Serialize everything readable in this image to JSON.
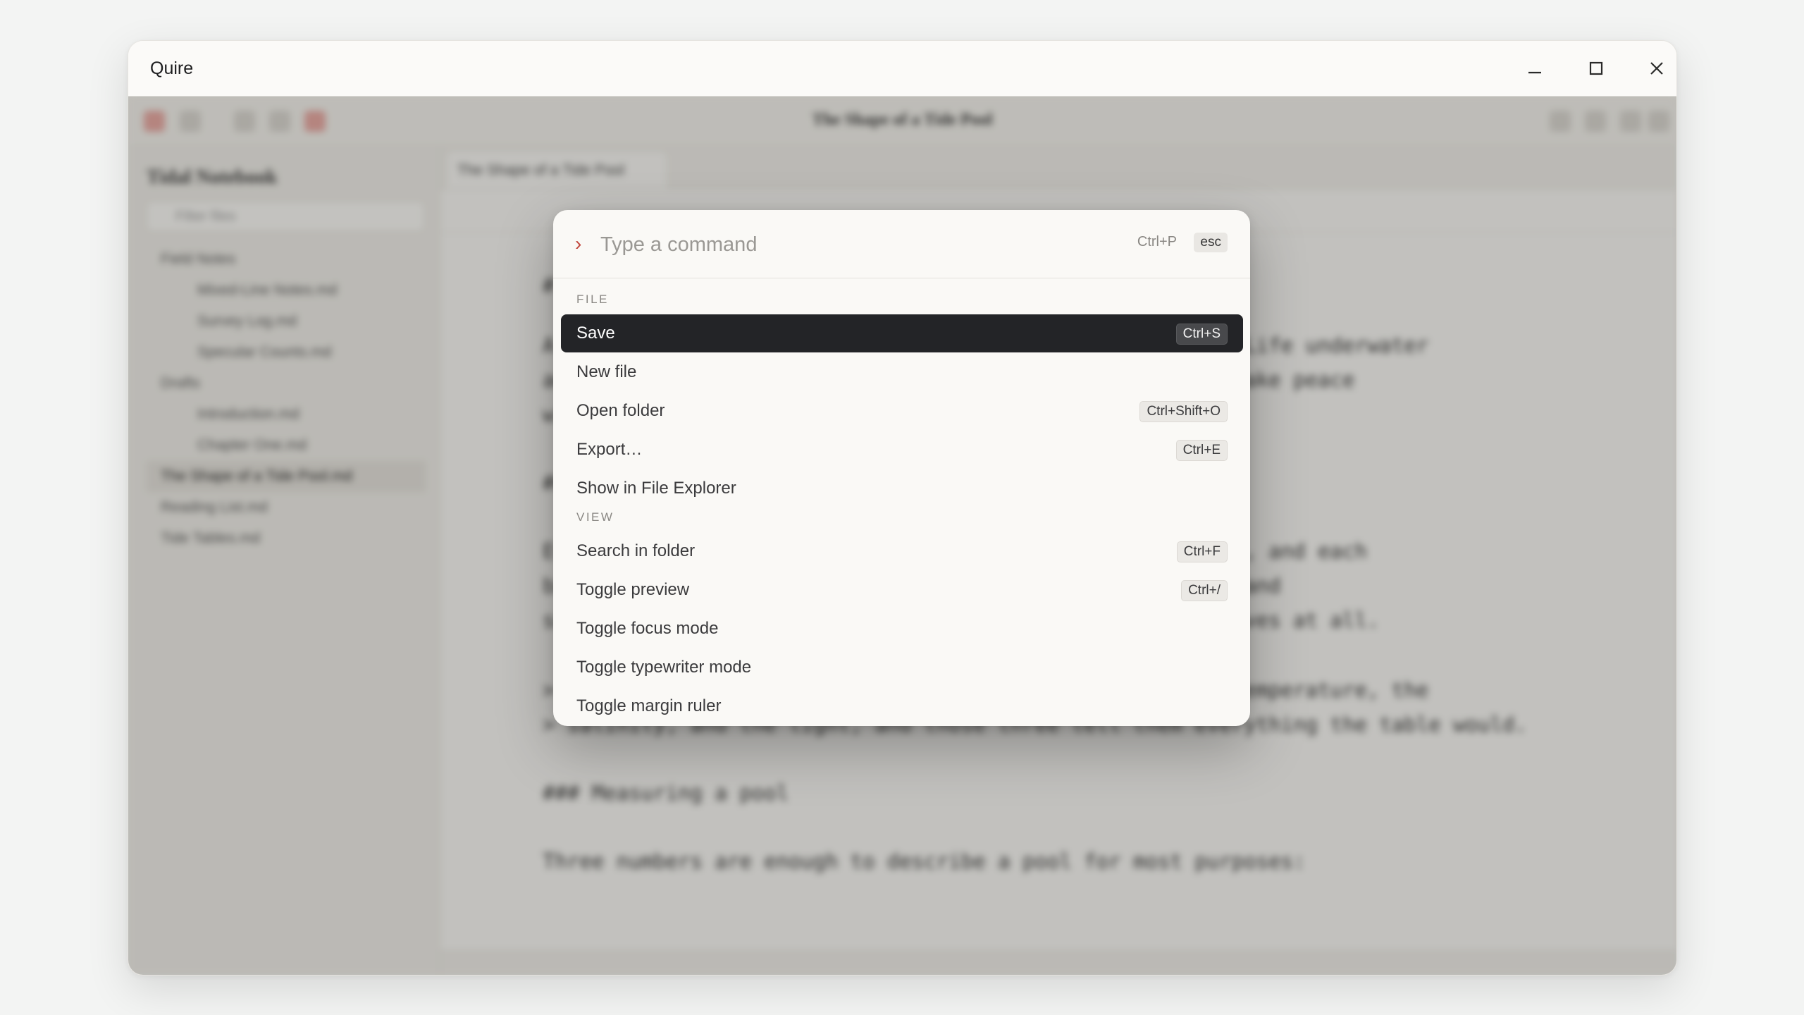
{
  "window": {
    "title": "Quire"
  },
  "background_app": {
    "document_title": "The Shape of a Tide Pool",
    "sidebar": {
      "notebook_title": "Tidal Notebook",
      "filter_placeholder": "Filter files",
      "tree": [
        {
          "label": "Field Notes",
          "depth": 0
        },
        {
          "label": "Mixed-Line Notes.md",
          "depth": 1
        },
        {
          "label": "Survey Log.md",
          "depth": 1
        },
        {
          "label": "Specular Counts.md",
          "depth": 1
        },
        {
          "label": "Drafts",
          "depth": 0
        },
        {
          "label": "Introduction.md",
          "depth": 1
        },
        {
          "label": "Chapter One.md",
          "depth": 1
        },
        {
          "label": "The Shape of a Tide Pool.md",
          "depth": 0,
          "selected": true
        },
        {
          "label": "Reading List.md",
          "depth": 0
        },
        {
          "label": "Tide Tables.md",
          "depth": 0
        }
      ]
    },
    "tab_label": "The Shape of a Tide Pool",
    "editor_lines": [
      "# The Shape of a Tide Pool",
      "A tide pool is a small world that the sea leaves behind. Life underwater",
      "adapts to it, and the pool itself is a lesson in how to make peace",
      "with change.",
      "## Zones",
      "Every rocky shore is divided into bands of shallow basins, and each",
      "band has its own residents. The high pools will run warm and",
      "salty; the low pools barely notice the tide, it barely moves at all.",
      "> The animals do not read the tide table. They read the temperature, the",
      "> salinity, and the light, and those three tell them everything the table would.",
      "### Measuring a pool",
      "Three numbers are enough to describe a pool for most purposes:"
    ]
  },
  "palette": {
    "prompt_symbol": "›",
    "input_placeholder": "Type a command",
    "open_shortcut": "Ctrl+P",
    "escape_key": "esc",
    "sections": [
      {
        "label": "FILE",
        "items": [
          {
            "label": "Save",
            "shortcut": "Ctrl+S",
            "selected": true
          },
          {
            "label": "New file",
            "shortcut": ""
          },
          {
            "label": "Open folder",
            "shortcut": "Ctrl+Shift+O"
          },
          {
            "label": "Export…",
            "shortcut": "Ctrl+E"
          },
          {
            "label": "Show in File Explorer",
            "shortcut": ""
          }
        ]
      },
      {
        "label": "VIEW",
        "items": [
          {
            "label": "Search in folder",
            "shortcut": "Ctrl+F"
          },
          {
            "label": "Toggle preview",
            "shortcut": "Ctrl+/"
          },
          {
            "label": "Toggle focus mode",
            "shortcut": ""
          },
          {
            "label": "Toggle typewriter mode",
            "shortcut": ""
          },
          {
            "label": "Toggle margin ruler",
            "shortcut": ""
          }
        ]
      }
    ]
  }
}
